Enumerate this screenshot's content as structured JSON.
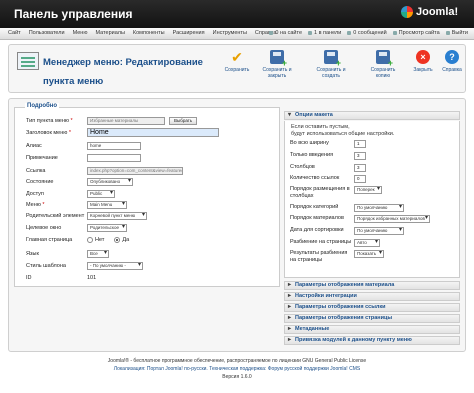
{
  "header": {
    "title": "Панель управления",
    "logo": "Joomla!"
  },
  "menubar": {
    "items": [
      "Сайт",
      "Пользователи",
      "Меню",
      "Материалы",
      "Компоненты",
      "Расширения",
      "Инструменты",
      "Справка"
    ],
    "status": [
      "0 на сайте",
      "1 в панели",
      "0 сообщений",
      "Просмотр сайта",
      "Выйти"
    ]
  },
  "page_title": "Менеджер меню: Редактирование пункта меню",
  "toolbar": {
    "save": "Сохранить",
    "save_close": "Сохранить и закрыть",
    "save_new": "Сохранить и создать",
    "save_copy": "Сохранить копию",
    "close": "Закрыть",
    "help": "Справка"
  },
  "details": {
    "legend": "Подробно",
    "type_label": "Тип пункта меню",
    "type_value": "Избранные материалы",
    "select_btn": "Выбрать",
    "title_label": "Заголовок меню",
    "title_value": "Home",
    "alias_label": "Алиас",
    "alias_value": "home",
    "note_label": "Примечание",
    "note_value": "",
    "link_label": "Ссылка",
    "link_value": "index.php?option=com_content&view=featured",
    "state_label": "Состояние",
    "state_value": "Опубликовано",
    "access_label": "Доступ",
    "access_value": "Public",
    "menu_label": "Меню",
    "menu_value": "Main Menu",
    "parent_label": "Родительский элемент",
    "parent_value": "Корневой пункт меню",
    "target_label": "Целевое окно",
    "target_value": "Родительское",
    "home_label": "Главная страница",
    "home_no": "Нет",
    "home_yes": "Да",
    "lang_label": "Язык",
    "lang_value": "Все",
    "style_label": "Стиль шаблона",
    "style_value": "- По умолчанию -",
    "id_label": "ID",
    "id_value": "101"
  },
  "options": {
    "header": "Опции макета",
    "desc_line1": "Если оставить пустым,",
    "desc_line2": "будут использоваться общие настройки.",
    "rows": [
      {
        "label": "Во всю ширину",
        "value": "1"
      },
      {
        "label": "Только введения",
        "value": "3"
      },
      {
        "label": "Столбцов",
        "value": "3"
      },
      {
        "label": "Количество ссылок",
        "value": "0"
      },
      {
        "label": "Порядок размещения в столбцах",
        "value": "Поперек"
      },
      {
        "label": "Порядок категорий",
        "value": "По умолчанию"
      },
      {
        "label": "Порядок материалов",
        "value": "Порядок избранных материалов"
      },
      {
        "label": "Дата для сортировки",
        "value": "По умолчанию"
      },
      {
        "label": "Разбиение на страницы",
        "value": "Авто"
      },
      {
        "label": "Результаты разбиения на страницы",
        "value": "Показать"
      }
    ]
  },
  "accordions": [
    "Параметры отображения материала",
    "Настройки интеграции",
    "Параметры отображения ссылки",
    "Параметры отображения страницы",
    "Метаданные",
    "Привязка модулей к данному пункту меню"
  ],
  "footer": {
    "line1": "Joomla!® - бесплатное программное обеспечение, распространяемое по лицензии GNU General Public License",
    "line2": "Локализация: Портал Joomla! по-русски. Техническая поддержка: Форум русской поддержки Joomla! CMS",
    "version": "Версия 1.6.0"
  }
}
